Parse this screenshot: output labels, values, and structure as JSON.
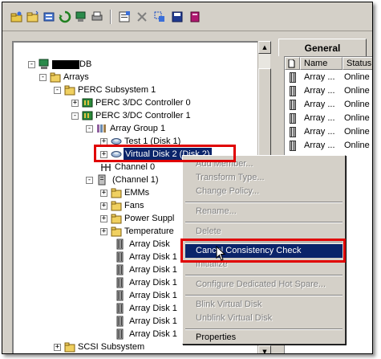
{
  "toolbar": {
    "icons": [
      "open-icon",
      "folder-icon",
      "scan-icon",
      "refresh-icon",
      "computer-icon",
      "print-icon",
      "properties-icon",
      "delete-icon",
      "select-icon",
      "save-icon",
      "help-book-icon"
    ]
  },
  "tree": {
    "root_label": "DB",
    "arrays": "Arrays",
    "subsystem": "PERC Subsystem 1",
    "controller0": "PERC 3/DC Controller 0",
    "controller1": "PERC 3/DC Controller 1",
    "array_group": "Array Group 1",
    "test1": "Test 1 (Disk 1)",
    "vdisk2": "Virtual Disk 2 (Disk 2)",
    "channel0": "Channel 0",
    "channel1": "(Channel 1)",
    "emms": "EMMs",
    "fans": "Fans",
    "power": "Power Suppl",
    "temperature": "Temperature",
    "array_disks": [
      "Array Disk",
      "Array Disk 1",
      "Array Disk 1",
      "Array Disk 1",
      "Array Disk 1",
      "Array Disk 1",
      "Array Disk 1",
      "Array Disk 1"
    ],
    "scsi": "SCSI Subsystem"
  },
  "right": {
    "tab_label": "General",
    "col_name": "Name",
    "col_status": "Status",
    "rows": [
      {
        "name": "Array ...",
        "status": "Online"
      },
      {
        "name": "Array ...",
        "status": "Online"
      },
      {
        "name": "Array ...",
        "status": "Online"
      },
      {
        "name": "Array ...",
        "status": "Online"
      },
      {
        "name": "Array ...",
        "status": "Online"
      },
      {
        "name": "Array ...",
        "status": "Online"
      }
    ]
  },
  "context_menu": {
    "add_member": "Add Member...",
    "transform_type": "Transform Type...",
    "change_policy": "Change Policy...",
    "rename": "Rename...",
    "delete": "Delete",
    "cancel_consistency": "Cancel Consistency Check",
    "initialize": "Initialize",
    "configure_hot_spare": "Configure Dedicated Hot Spare...",
    "blink": "Blink Virtual Disk",
    "unblink": "Unblink Virtual Disk",
    "properties": "Properties"
  },
  "colors": {
    "selection": "#0a246a",
    "highlight_box": "#e00000",
    "window_bg": "#d4d0c8"
  }
}
